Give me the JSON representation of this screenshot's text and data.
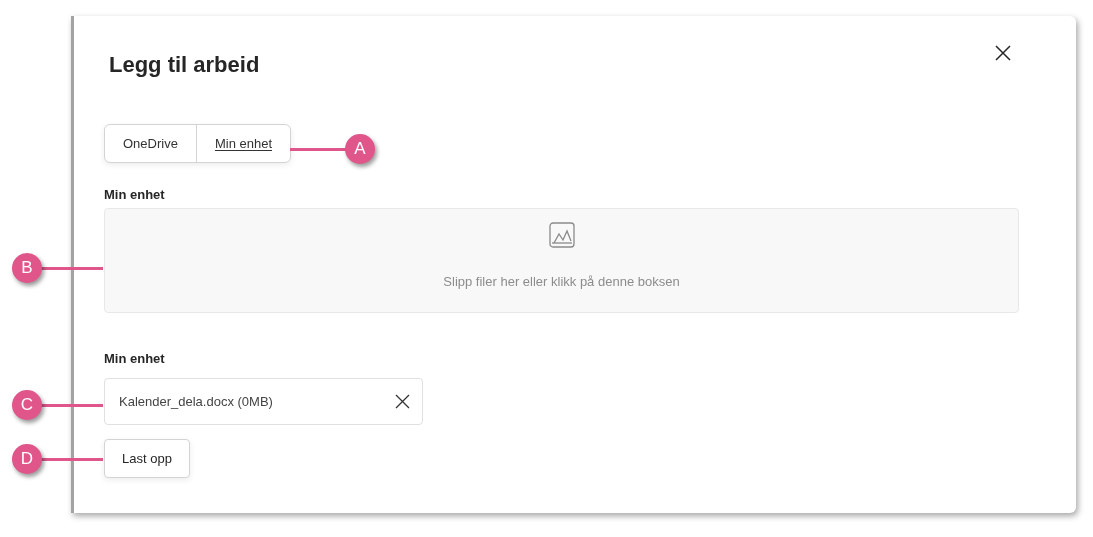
{
  "dialog": {
    "title": "Legg til arbeid"
  },
  "source_tabs": [
    {
      "label": "OneDrive",
      "selected": false
    },
    {
      "label": "Min enhet",
      "selected": true
    }
  ],
  "drop_section": {
    "label": "Min enhet",
    "hint": "Slipp filer her eller klikk på denne boksen"
  },
  "files_section": {
    "label": "Min enhet",
    "files": [
      {
        "name": "Kalender_dela.docx (0MB)"
      }
    ]
  },
  "upload_button": "Last opp",
  "callouts": [
    {
      "letter": "A"
    },
    {
      "letter": "B"
    },
    {
      "letter": "C"
    },
    {
      "letter": "D"
    }
  ]
}
